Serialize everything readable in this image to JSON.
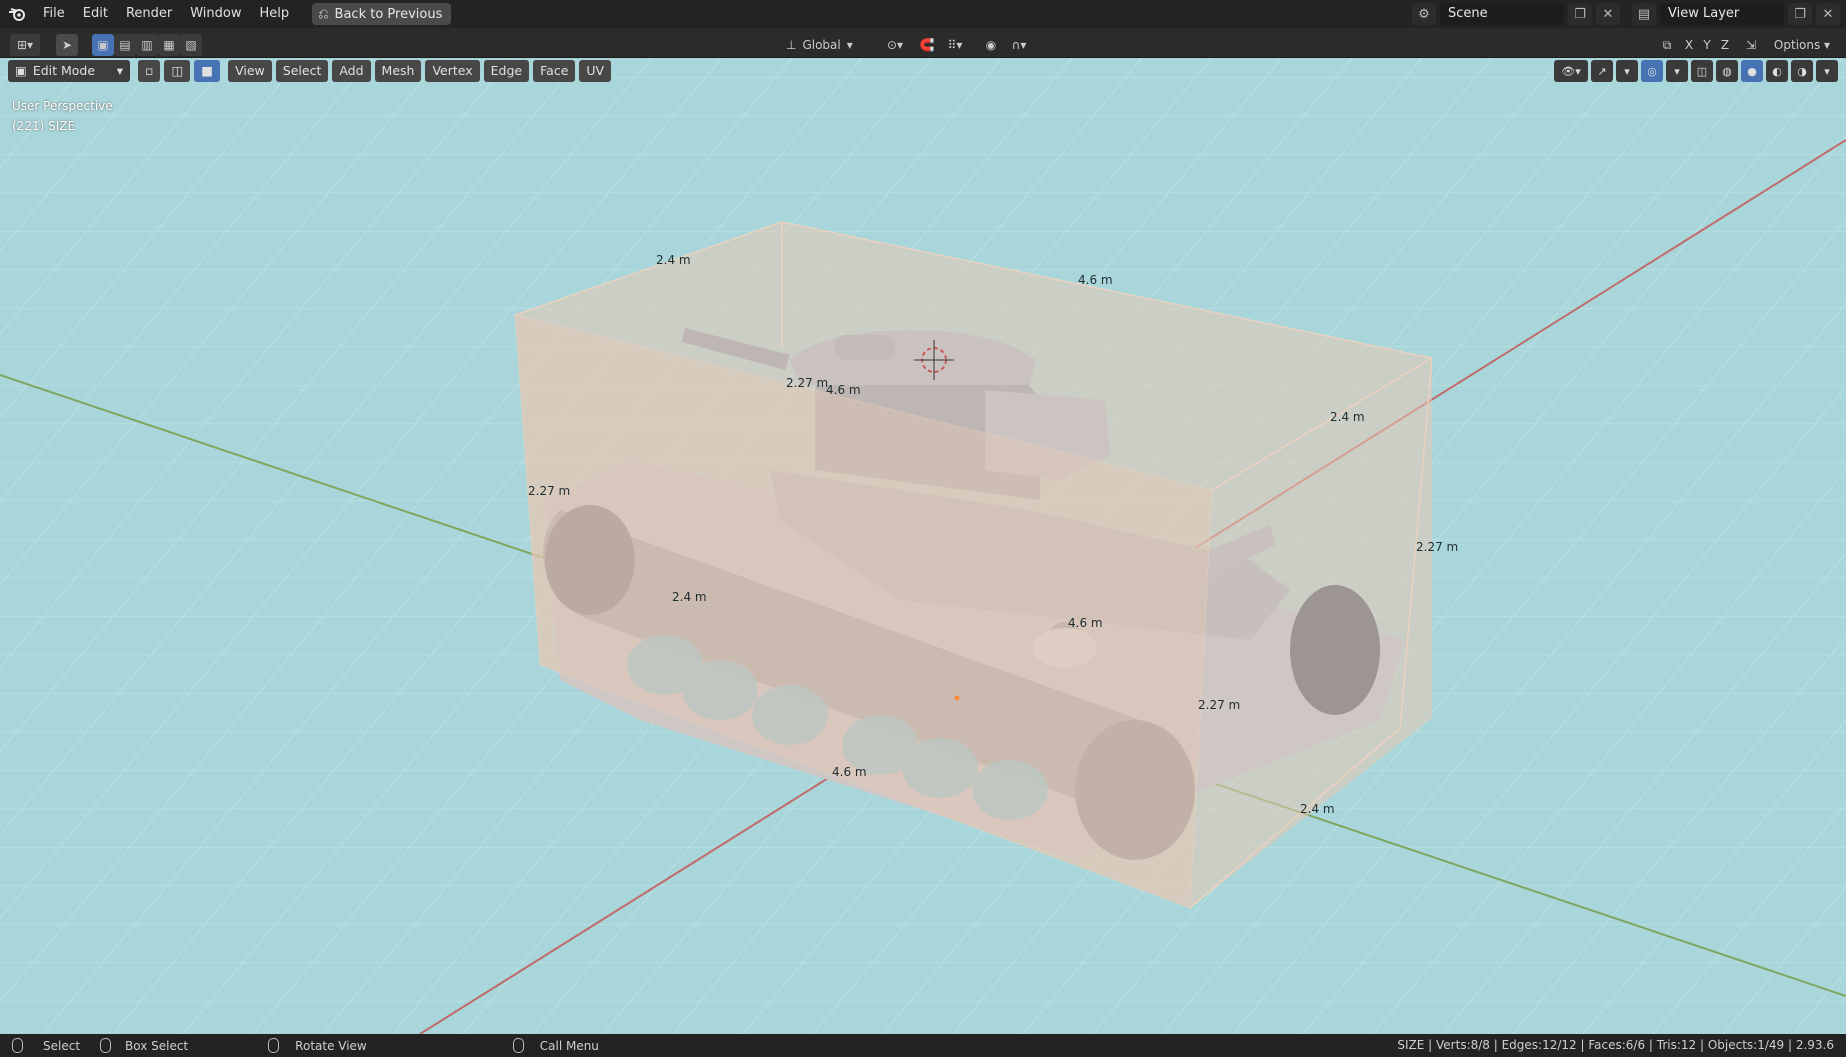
{
  "menu": {
    "file": "File",
    "edit": "Edit",
    "render": "Render",
    "window": "Window",
    "help": "Help",
    "back": "Back to Previous"
  },
  "scene": {
    "scene_name": "Scene",
    "view_layer": "View Layer"
  },
  "toolbar": {
    "orientation": "Global",
    "options": "Options",
    "axis_x": "X",
    "axis_y": "Y",
    "axis_z": "Z"
  },
  "viewport_header": {
    "mode": "Edit Mode",
    "view": "View",
    "select": "Select",
    "add": "Add",
    "mesh": "Mesh",
    "vertex": "Vertex",
    "edge": "Edge",
    "face": "Face",
    "uv": "UV"
  },
  "overlay": {
    "perspective": "User Perspective",
    "object_info": "(221) SIZE"
  },
  "dimensions": [
    "2.4 m",
    "4.6 m",
    "2.27 m",
    "4.6 m",
    "2.4 m",
    "2.27 m",
    "2.27 m",
    "2.4 m",
    "4.6 m",
    "2.27 m",
    "4.6 m",
    "2.4 m"
  ],
  "status": {
    "select": "Select",
    "box_select": "Box Select",
    "rotate_view": "Rotate View",
    "call_menu": "Call Menu",
    "stats": "SIZE | Verts:8/8 | Edges:12/12 | Faces:6/6 | Tris:12 | Objects:1/49 | 2.93.6"
  },
  "colors": {
    "background": "#a8d6da",
    "grid": "#bfe0e3",
    "x_axis": "#c06a6a",
    "y_axis": "#7ea65f",
    "box_fill": "#e7c8b4",
    "box_edge": "#f1d2bd",
    "tank": "#cfc7c4"
  }
}
